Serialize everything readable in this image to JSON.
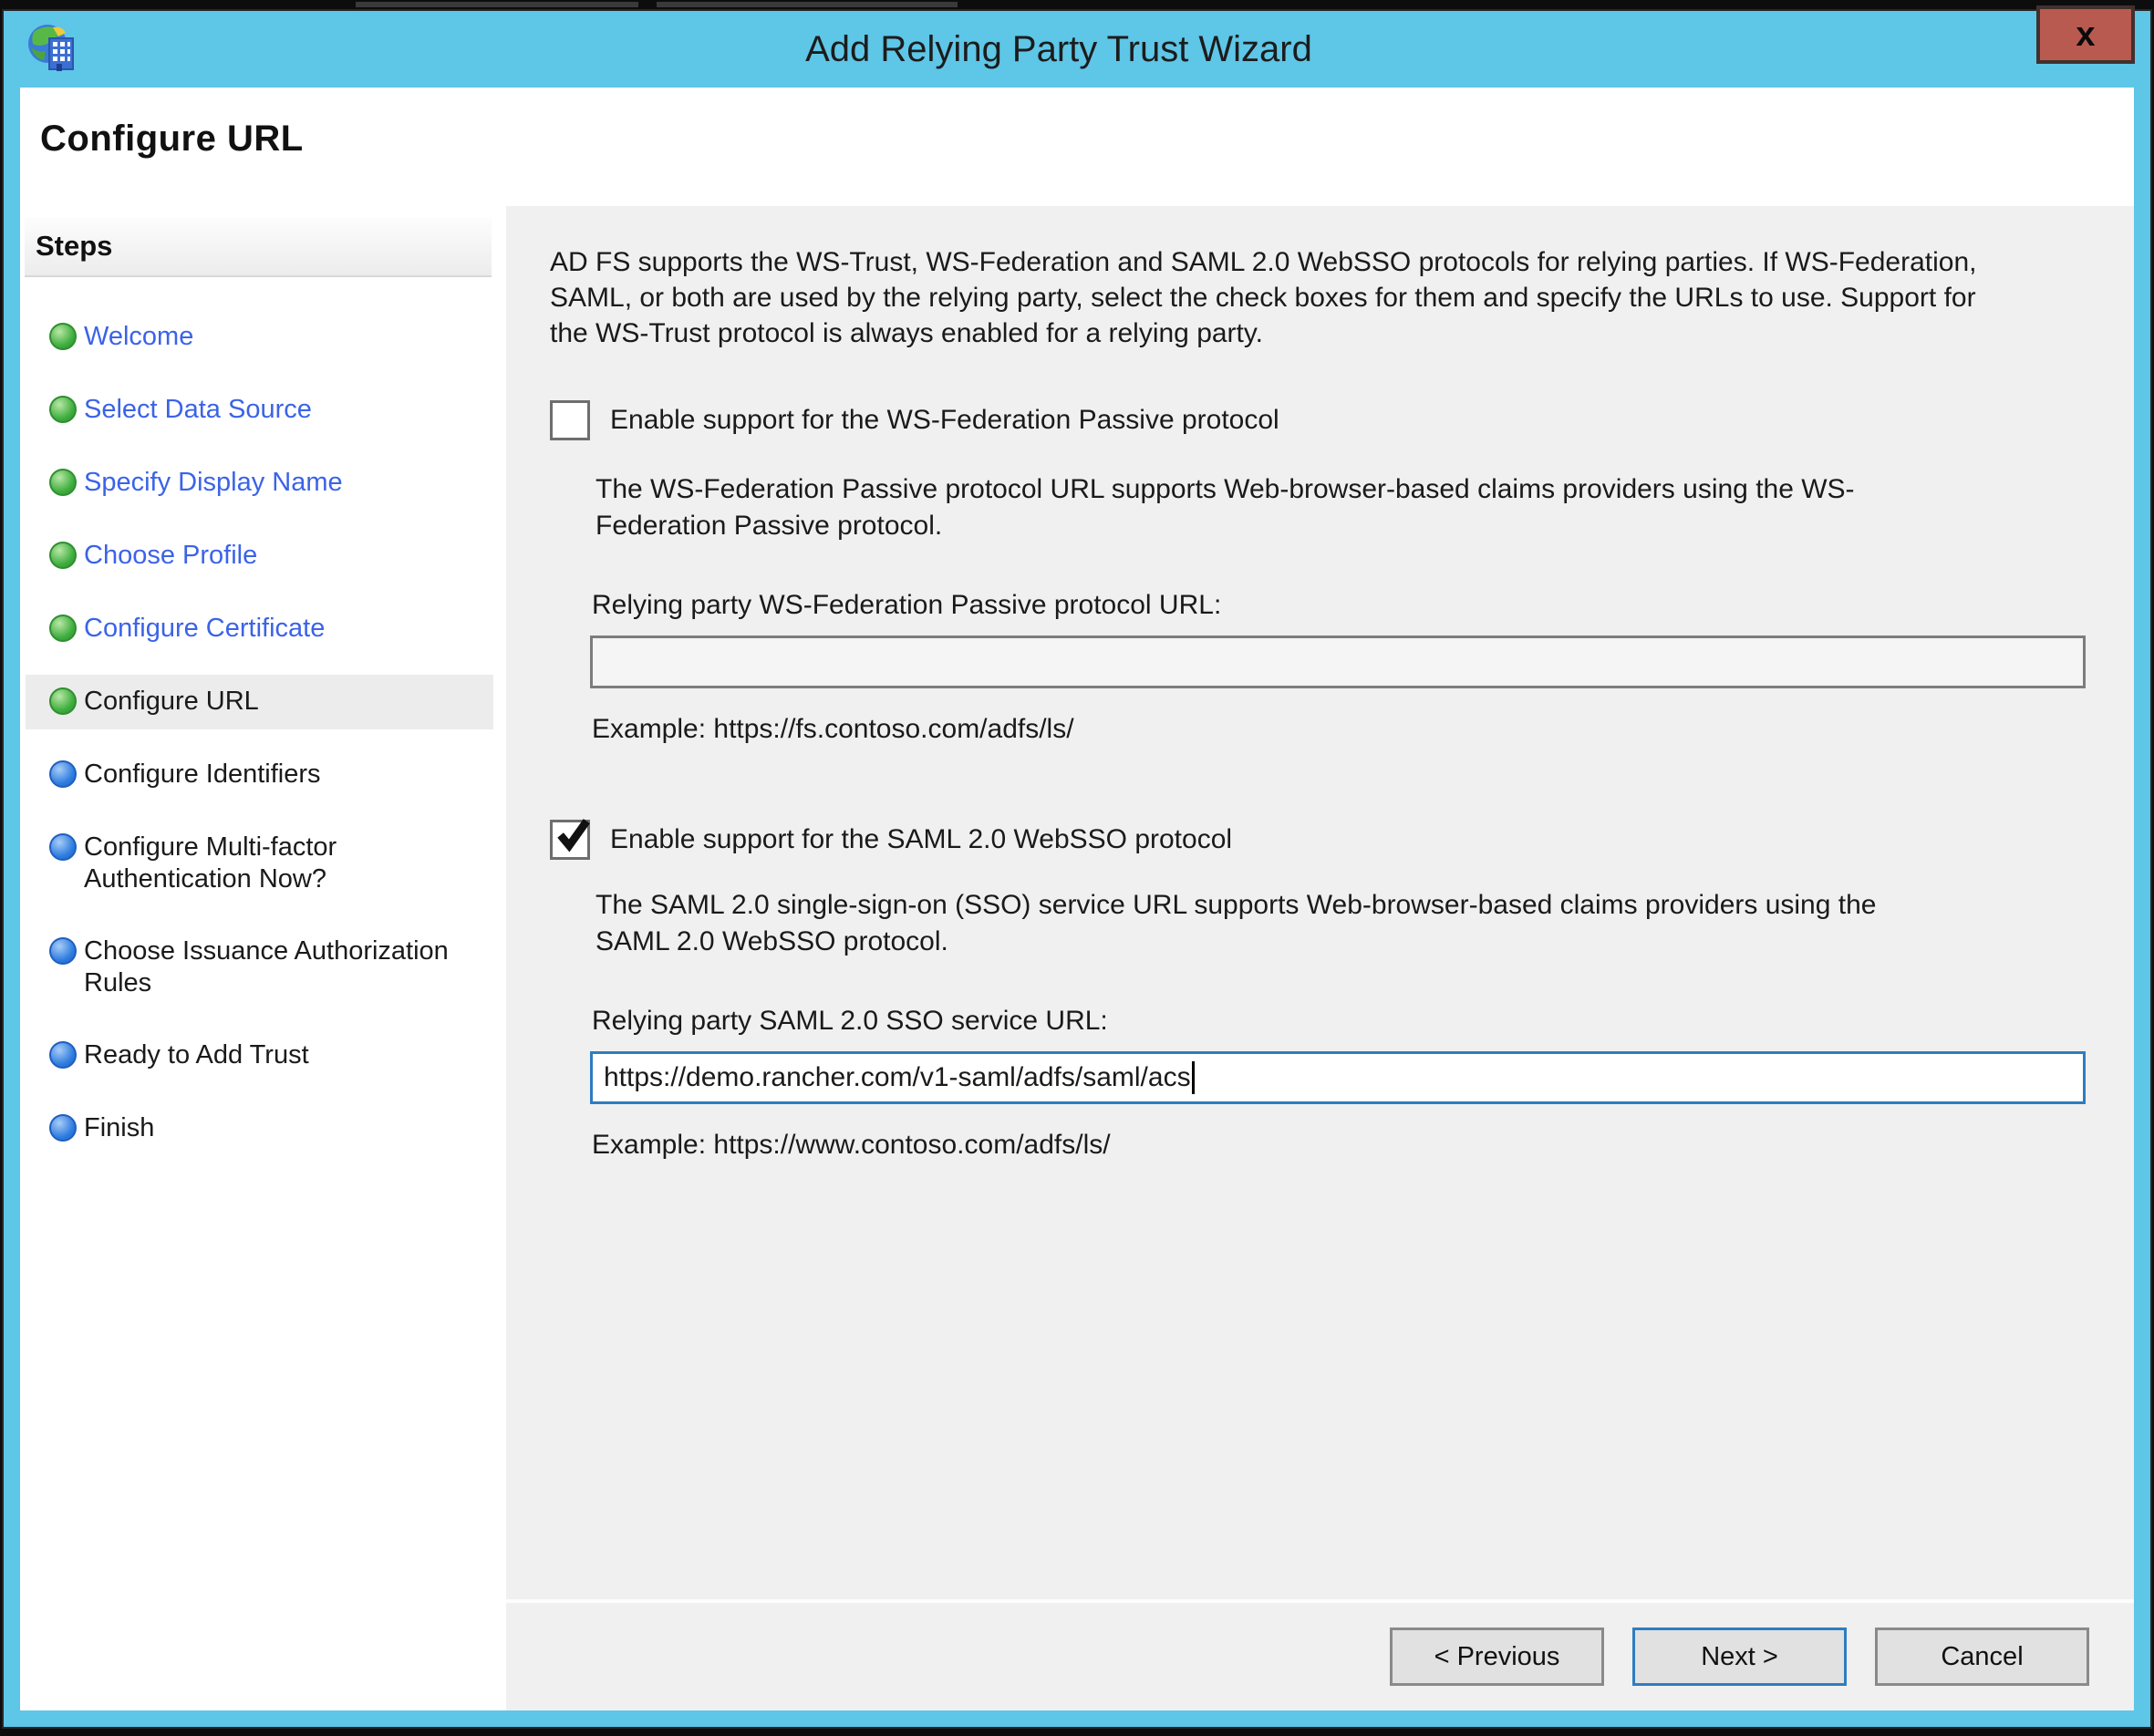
{
  "window": {
    "title": "Add Relying Party Trust Wizard",
    "close_label": "x"
  },
  "page": {
    "heading": "Configure URL"
  },
  "sidebar": {
    "heading": "Steps",
    "steps": [
      {
        "label": "Welcome",
        "state": "done"
      },
      {
        "label": "Select Data Source",
        "state": "done"
      },
      {
        "label": "Specify Display Name",
        "state": "done"
      },
      {
        "label": "Choose Profile",
        "state": "done"
      },
      {
        "label": "Configure Certificate",
        "state": "done"
      },
      {
        "label": "Configure URL",
        "state": "current"
      },
      {
        "label": "Configure Identifiers",
        "state": "upcoming"
      },
      {
        "label": "Configure Multi-factor Authentication Now?",
        "state": "upcoming"
      },
      {
        "label": "Choose Issuance Authorization Rules",
        "state": "upcoming"
      },
      {
        "label": "Ready to Add Trust",
        "state": "upcoming"
      },
      {
        "label": "Finish",
        "state": "upcoming"
      }
    ]
  },
  "content": {
    "intro": "AD FS supports the WS-Trust, WS-Federation and SAML 2.0 WebSSO protocols for relying parties.  If WS-Federation, SAML, or both are used by the relying party, select the check boxes for them and specify the URLs to use.  Support for the WS-Trust protocol is always enabled for a relying party.",
    "wsfed": {
      "checkbox_label": "Enable support for the WS-Federation Passive protocol",
      "checked": false,
      "description": "The WS-Federation Passive protocol URL supports Web-browser-based claims providers using the WS-Federation Passive protocol.",
      "url_label": "Relying party WS-Federation Passive protocol URL:",
      "url_value": "",
      "example": "Example: https://fs.contoso.com/adfs/ls/"
    },
    "saml": {
      "checkbox_label": "Enable support for the SAML 2.0 WebSSO protocol",
      "checked": true,
      "description": "The SAML 2.0 single-sign-on (SSO) service URL supports Web-browser-based claims providers using the SAML 2.0 WebSSO protocol.",
      "url_label": "Relying party SAML 2.0 SSO service URL:",
      "url_value": "https://demo.rancher.com/v1-saml/adfs/saml/acs",
      "example": "Example: https://www.contoso.com/adfs/ls/"
    }
  },
  "footer": {
    "previous_label": "< Previous",
    "next_label": "Next >",
    "cancel_label": "Cancel"
  },
  "colors": {
    "titlebar": "#5EC6E7",
    "close": "#B95A50",
    "link": "#3B63E8",
    "focus": "#2D7DC1",
    "dotgreen": "#3FAE3F",
    "dotblue": "#2F7DE0",
    "contentbg": "#F0F0F0"
  }
}
